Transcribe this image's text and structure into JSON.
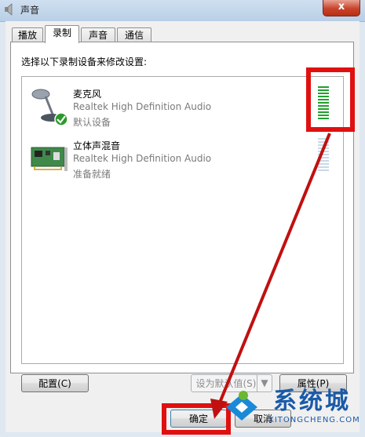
{
  "window": {
    "title": "声音",
    "close_symbol": "x"
  },
  "tabs": [
    {
      "label": "播放",
      "active": false
    },
    {
      "label": "录制",
      "active": true
    },
    {
      "label": "声音",
      "active": false
    },
    {
      "label": "通信",
      "active": false
    }
  ],
  "instruction": "选择以下录制设备来修改设置:",
  "devices": [
    {
      "name": "麦克风",
      "description": "Realtek High Definition Audio",
      "status": "默认设备",
      "icon": "microphone-icon",
      "level_fraction": 1.0,
      "meter_color": "#22a02e"
    },
    {
      "name": "立体声混音",
      "description": "Realtek High Definition Audio",
      "status": "准备就绪",
      "icon": "sound-card-icon",
      "level_fraction": 0.0,
      "meter_color": "#c9d8e6"
    }
  ],
  "buttons": {
    "configure": "配置(C)",
    "set_default": "设为默认值(S)",
    "set_default_arrow": "▼",
    "properties": "属性(P)",
    "ok": "确定",
    "cancel": "取消"
  },
  "watermark": {
    "text": "系统城",
    "url": "XITONGCHENG.COM"
  },
  "colors": {
    "highlight_box": "#e01010",
    "arrow": "#c01010",
    "accent": "#1a5aa8"
  }
}
